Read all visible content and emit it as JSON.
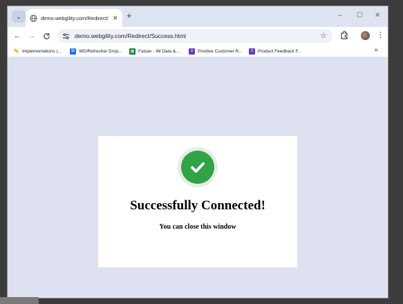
{
  "browser": {
    "tab": {
      "title": "demo.webgility.com/Redirect/S"
    },
    "address_bar": {
      "url": "demo.webgility.com/Redirect/Success.html"
    },
    "window_controls": {
      "minimize": "–",
      "maximize": "☐",
      "close": "✕"
    }
  },
  "bookmarks": [
    {
      "label": "Implementations |...",
      "icon": "pen-icon",
      "color": "#f4b400"
    },
    {
      "label": "WD/Refresher Drop...",
      "icon": "shield-icon",
      "color": "#1a73e8"
    },
    {
      "label": "Faizan - IM Data &...",
      "icon": "sheets-icon",
      "color": "#188038"
    },
    {
      "label": "Positive Customer R...",
      "icon": "forms-icon",
      "color": "#673ab7"
    },
    {
      "label": "Product Feedback F...",
      "icon": "forms-icon",
      "color": "#673ab7"
    }
  ],
  "page": {
    "title": "Successfully Connected!",
    "subtitle": "You can close this window",
    "accent_color": "#2fa345"
  }
}
